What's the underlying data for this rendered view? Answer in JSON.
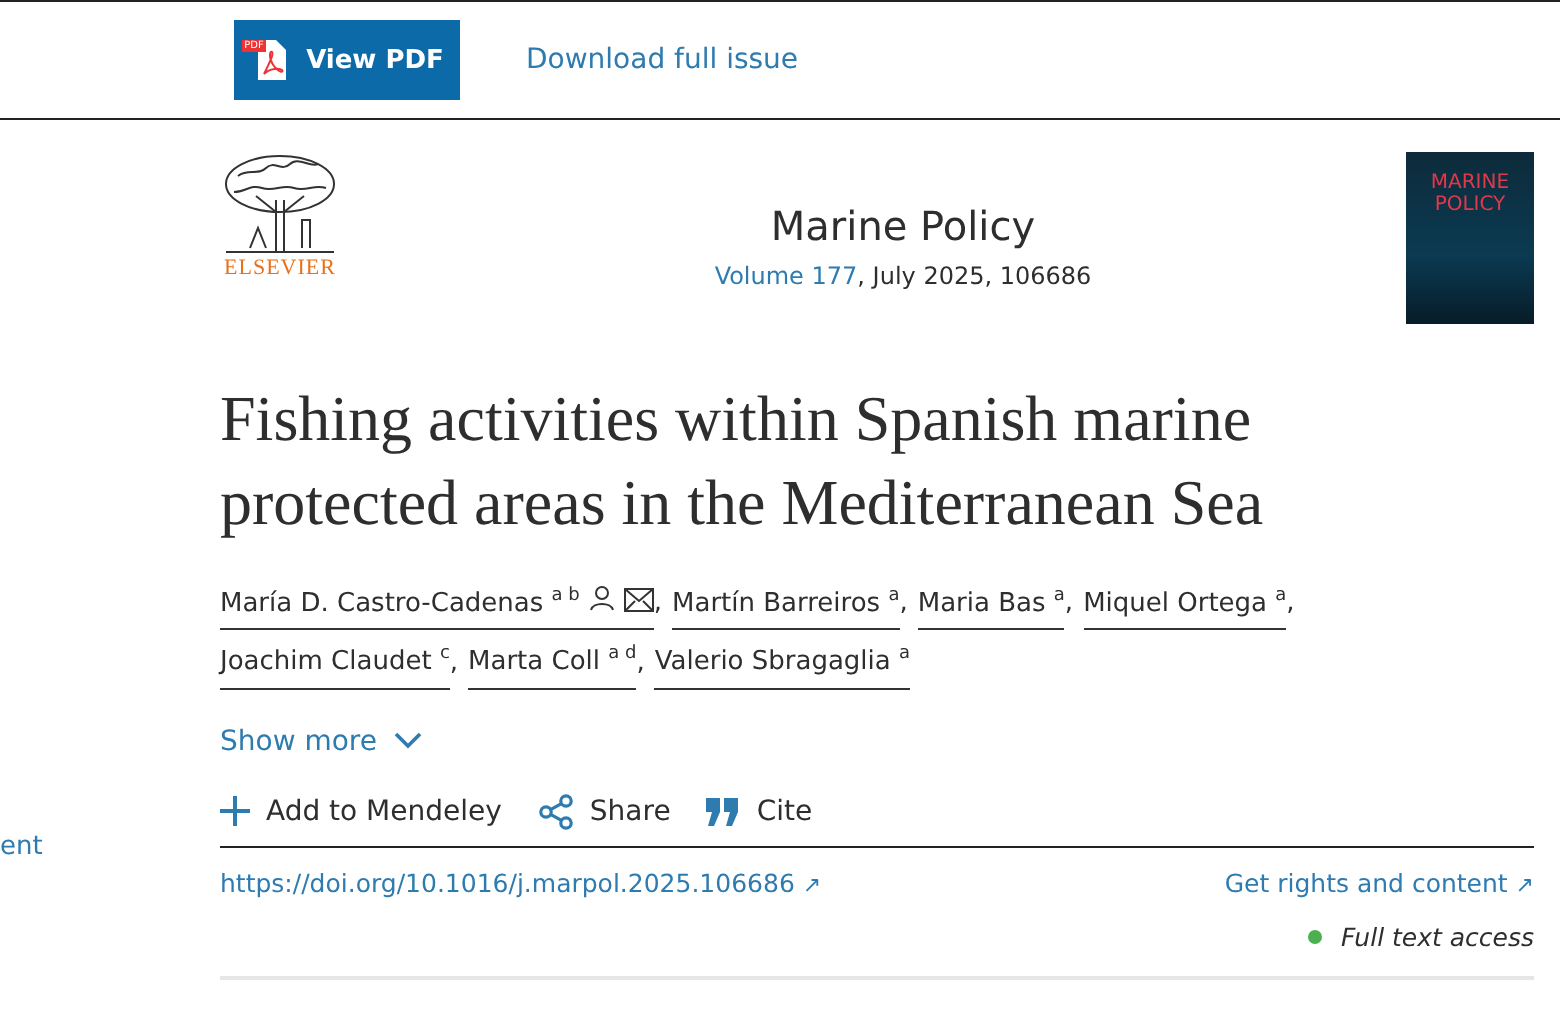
{
  "toolbar": {
    "pdf_button": "View PDF",
    "pdf_badge": "PDF",
    "download_link": "Download full issue"
  },
  "sidebar": {
    "cut_link": "ent"
  },
  "journal": {
    "publisher": "ELSEVIER",
    "name": "Marine Policy",
    "volume_link": "Volume 177",
    "issue_rest": ", July 2025, 106686",
    "cover_title": "MARINE POLICY"
  },
  "article": {
    "title": "Fishing activities within Spanish marine protected areas in the Mediterranean Sea",
    "authors": [
      {
        "name": "María D. Castro-Cadenas",
        "sup": "a b",
        "corresponding": true
      },
      {
        "name": "Martín Barreiros",
        "sup": "a",
        "corresponding": false
      },
      {
        "name": "Maria Bas",
        "sup": "a",
        "corresponding": false
      },
      {
        "name": "Miquel Ortega",
        "sup": "a",
        "corresponding": false
      },
      {
        "name": "Joachim Claudet",
        "sup": "c",
        "corresponding": false
      },
      {
        "name": "Marta Coll",
        "sup": "a d",
        "corresponding": false
      },
      {
        "name": "Valerio Sbragaglia",
        "sup": "a",
        "corresponding": false
      }
    ],
    "show_more": "Show more",
    "actions": [
      {
        "kind": "add",
        "label": "Add to Mendeley"
      },
      {
        "kind": "share",
        "label": "Share"
      },
      {
        "kind": "cite",
        "label": "Cite"
      }
    ],
    "doi": "https://doi.org/10.1016/j.marpol.2025.106686",
    "doi_arrow": "↗",
    "rights": "Get rights and content",
    "rights_arrow": "↗",
    "separator": ",",
    "access": {
      "label": "Full text access",
      "color": "#4caf50"
    }
  }
}
